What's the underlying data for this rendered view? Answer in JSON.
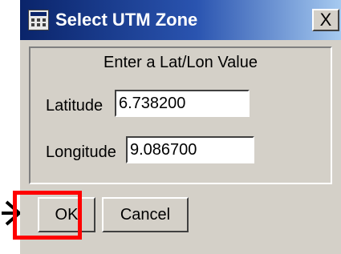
{
  "window": {
    "title": "Select UTM Zone",
    "close_glyph": "X"
  },
  "form": {
    "prompt": "Enter a Lat/Lon Value",
    "latitude": {
      "label": "Latitude",
      "value": "6.738200"
    },
    "longitude": {
      "label": "Longitude",
      "value": "9.086700"
    }
  },
  "buttons": {
    "ok": "OK",
    "cancel": "Cancel"
  },
  "annotation": {
    "highlight_color": "#ff0000",
    "arrow_color": "#000000"
  },
  "icons": [
    "app-window-icon",
    "close-icon",
    "pointer-arrow-icon"
  ]
}
